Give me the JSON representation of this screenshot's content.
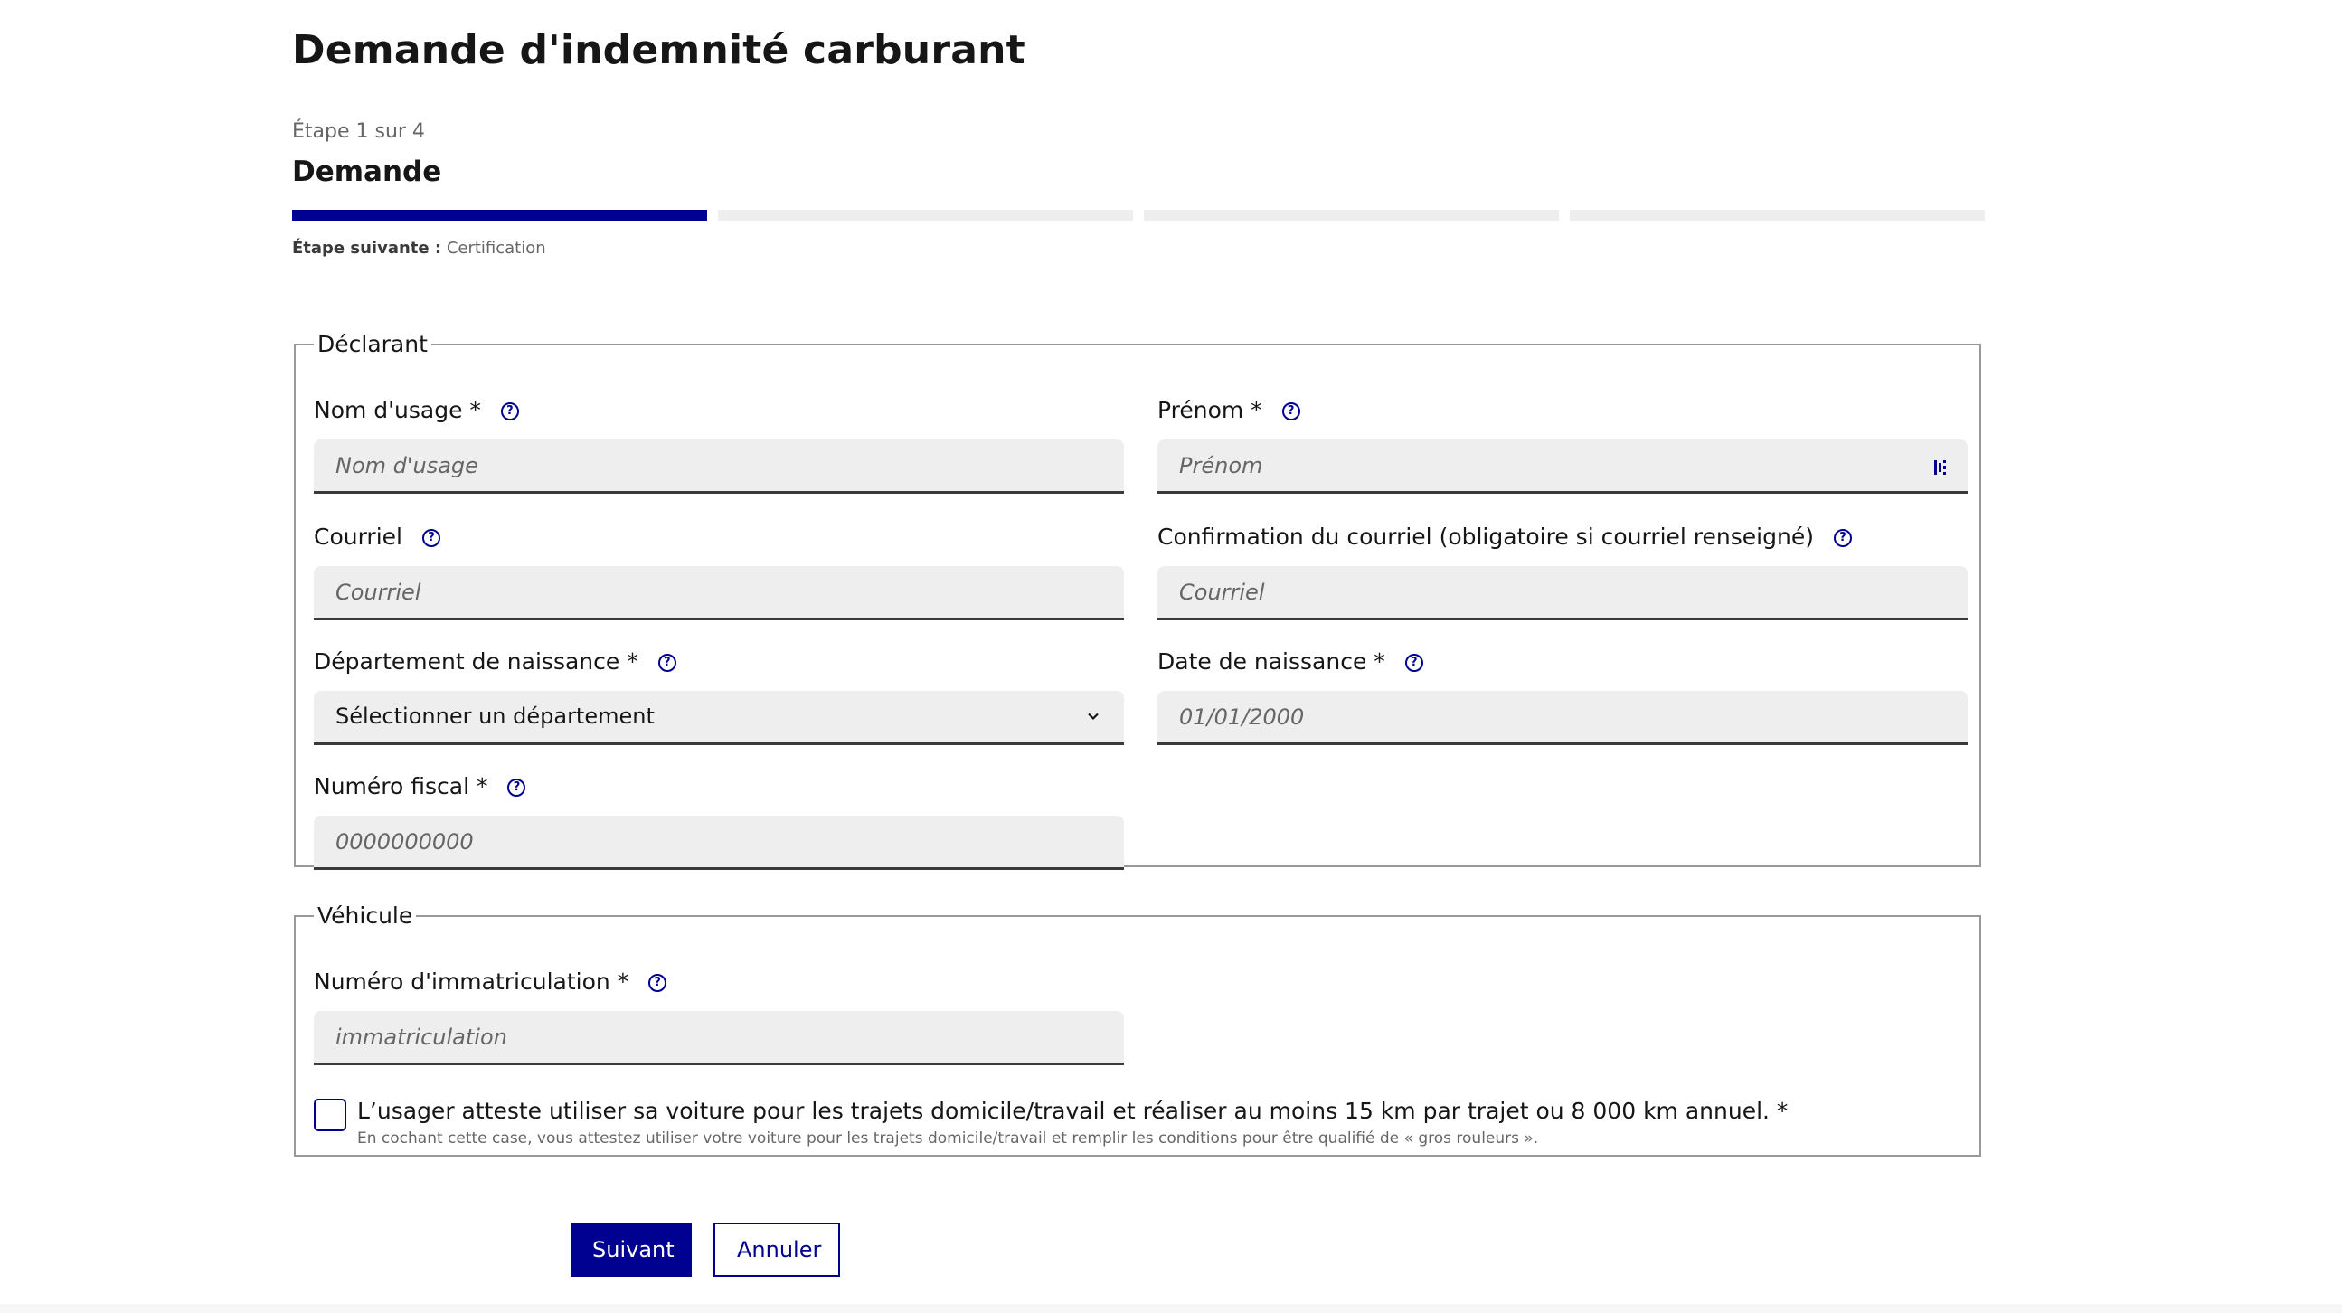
{
  "page": {
    "title": "Demande d'indemnité carburant"
  },
  "stepper": {
    "count_label": "Étape 1 sur 4",
    "current_title": "Demande",
    "total_steps": 4,
    "current_step": 1,
    "next_label": "Étape suivante :",
    "next_value": "Certification"
  },
  "declarant": {
    "legend": "Déclarant",
    "nom": {
      "label": "Nom d'usage *",
      "placeholder": "Nom d'usage",
      "value": ""
    },
    "prenom": {
      "label": "Prénom *",
      "placeholder": "Prénom",
      "value": ""
    },
    "courriel": {
      "label": "Courriel",
      "placeholder": "Courriel",
      "value": ""
    },
    "confirmation": {
      "label": "Confirmation du courriel (obligatoire si courriel renseigné)",
      "placeholder": "Courriel",
      "value": ""
    },
    "departement": {
      "label": "Département de naissance *",
      "selected": "Sélectionner un département"
    },
    "date_naissance": {
      "label": "Date de naissance *",
      "placeholder": "01/01/2000",
      "value": ""
    },
    "numero_fiscal": {
      "label": "Numéro fiscal *",
      "placeholder": "0000000000",
      "value": ""
    }
  },
  "vehicule": {
    "legend": "Véhicule",
    "immatriculation": {
      "label": "Numéro d'immatriculation *",
      "placeholder": "immatriculation",
      "value": ""
    },
    "attestation": {
      "label": "L’usager atteste utiliser sa voiture pour les trajets domicile/travail et réaliser au moins 15 km par trajet ou 8 000 km annuel. *",
      "hint": "En cochant cette case, vous attestez utiliser votre voiture pour les trajets domicile/travail et remplir les conditions pour être qualifié de « gros rouleurs ».",
      "checked": false
    }
  },
  "actions": {
    "next": "Suivant",
    "cancel": "Annuler"
  },
  "icons": {
    "help": "question-circle-icon",
    "select": "chevron-down-icon",
    "autofill": "password-manager-icon"
  },
  "colors": {
    "primary": "#000091",
    "input_bg": "#eeeeee",
    "border": "#999999"
  }
}
